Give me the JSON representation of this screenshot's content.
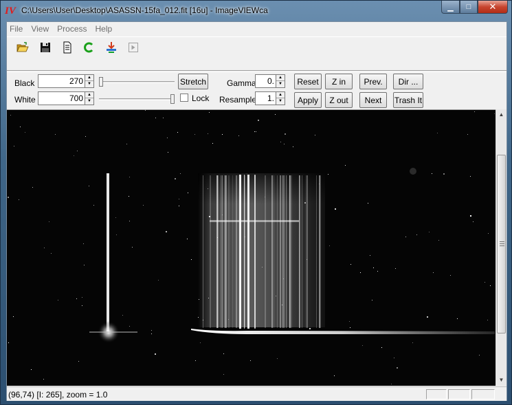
{
  "window": {
    "title": "C:\\Users\\User\\Desktop\\ASASSN-15fa_012.fit [16u] - ImageVIEWca",
    "icon_text": "IV",
    "minimize_glyph": "▁",
    "maximize_glyph": "□",
    "close_glyph": "✕"
  },
  "menu": [
    "File",
    "View",
    "Process",
    "Help"
  ],
  "toolbar": {
    "icons": [
      "open-folder-icon",
      "save-icon",
      "document-icon",
      "refresh-c-icon",
      "transfer-icon",
      "play-icon"
    ]
  },
  "controls": {
    "black_label": "Black",
    "black_value": "270",
    "white_label": "White",
    "white_value": "700",
    "black_slider_level": 0.0,
    "white_slider_level": 1.0,
    "stretch_label": "Stretch",
    "lock_label": "Lock",
    "lock_checked": false,
    "gamma_label": "Gamma",
    "gamma_value": "0.",
    "resample_label": "Resample",
    "resample_value": "1.",
    "reset_label": "Reset",
    "apply_label": "Apply",
    "zin_label": "Z in",
    "zout_label": "Z out",
    "prev_label": "Prev.",
    "next_label": "Next",
    "dir_label": "Dir ...",
    "trash_label": "Trash It"
  },
  "scrollbar": {
    "up_glyph": "▲",
    "down_glyph": "▼"
  },
  "status": {
    "text": "(96,74) [I: 265], zoom = 1.0"
  },
  "colors": {
    "accent_red": "#e21a1a",
    "image_bg": "#000000"
  }
}
